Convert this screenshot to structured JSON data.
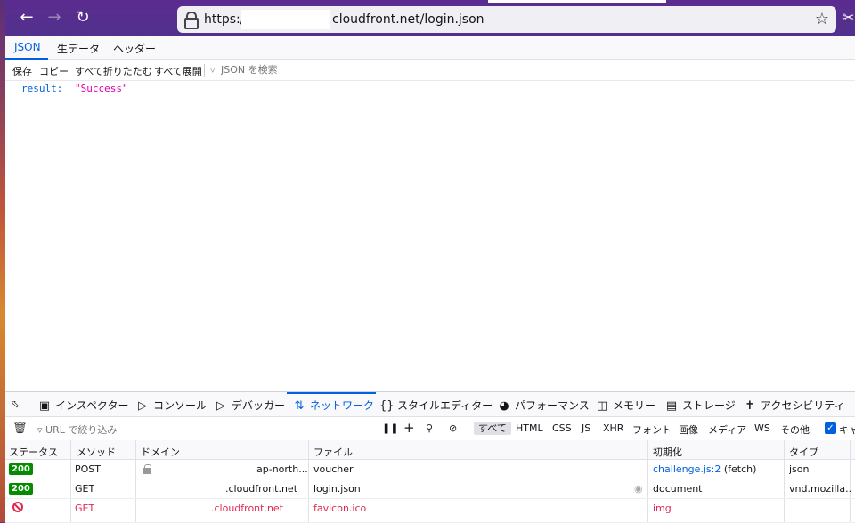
{
  "browser": {
    "url_prefix": "https://",
    "url_suffix": "cloudfront.net/login.json"
  },
  "viewer": {
    "tabs": [
      "JSON",
      "生データ",
      "ヘッダー"
    ],
    "actions": [
      "保存",
      "コピー",
      "すべて折りたたむ",
      "すべて展開"
    ],
    "filter_placeholder": "JSON を検索",
    "json": {
      "key": "result:",
      "value": "\"Success\""
    }
  },
  "devtools": {
    "tabs": [
      "インスペクター",
      "コンソール",
      "デバッガー",
      "ネットワーク",
      "スタイルエディター",
      "パフォーマンス",
      "メモリー",
      "ストレージ",
      "アクセシビリティ"
    ],
    "active_tab": "ネットワーク",
    "url_filter_placeholder": "URL で絞り込み",
    "filters": [
      "すべて",
      "HTML",
      "CSS",
      "JS",
      "XHR",
      "フォント",
      "画像",
      "メディア",
      "WS",
      "その他"
    ],
    "checkbox_label": "キャ",
    "columns": [
      "ステータス",
      "メソッド",
      "ドメイン",
      "ファイル",
      "初期化",
      "タイプ"
    ],
    "rows": [
      {
        "status": "200",
        "method": "POST",
        "domain": "ap-north...",
        "file": "voucher",
        "initiator": "challenge.js:2",
        "initiator_suffix": " (fetch)",
        "type": "json"
      },
      {
        "status": "200",
        "method": "GET",
        "domain": ".cloudfront.net",
        "file": "login.json",
        "initiator": "document",
        "initiator_suffix": "",
        "type": "vnd.mozilla...."
      },
      {
        "status": "",
        "method": "GET",
        "domain": ".cloudfront.net",
        "file": "favicon.ico",
        "initiator": "img",
        "initiator_suffix": "",
        "type": ""
      }
    ]
  }
}
